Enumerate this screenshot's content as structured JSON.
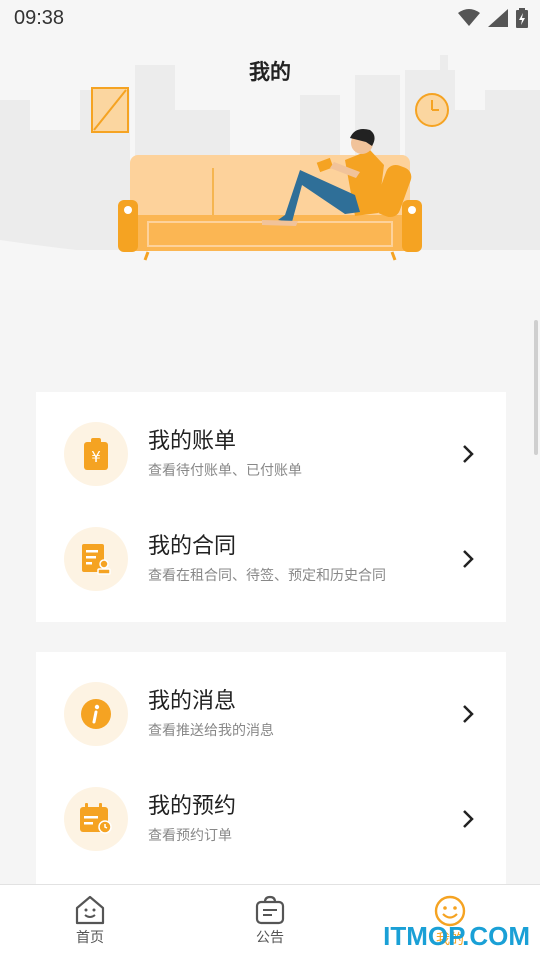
{
  "status_bar": {
    "time": "09:38"
  },
  "header": {
    "title": "我的"
  },
  "accent_color": "#f5a322",
  "menu_groups": [
    {
      "items": [
        {
          "title": "我的账单",
          "subtitle": "查看待付账单、已付账单",
          "icon": "bill-yuan-icon"
        },
        {
          "title": "我的合同",
          "subtitle": "查看在租合同、待签、预定和历史合同",
          "icon": "contract-document-icon"
        }
      ]
    },
    {
      "items": [
        {
          "title": "我的消息",
          "subtitle": "查看推送给我的消息",
          "icon": "info-message-icon"
        },
        {
          "title": "我的预约",
          "subtitle": "查看预约订单",
          "icon": "calendar-appointment-icon"
        }
      ]
    }
  ],
  "tab_bar": {
    "tabs": [
      {
        "label": "首页",
        "icon": "house-icon",
        "active": false
      },
      {
        "label": "公告",
        "icon": "notice-bag-icon",
        "active": false
      },
      {
        "label": "我的",
        "icon": "smiley-face-icon",
        "active": true
      }
    ]
  },
  "watermark": "ITMOP.COM"
}
